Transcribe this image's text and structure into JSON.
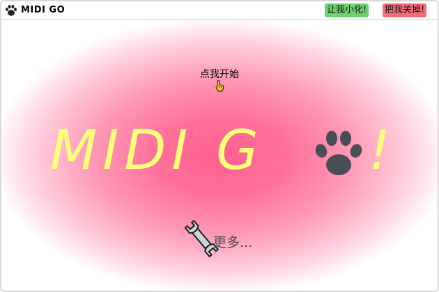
{
  "window": {
    "title": "MIDI GO",
    "icon": "paw-icon"
  },
  "titlebar": {
    "minimize_label": "让我小化!",
    "close_label": "把我关掉!",
    "minimize_color": "#6ed06e",
    "close_color": "#f26d78"
  },
  "main": {
    "start_label": "点我开始",
    "start_icon": "pointing-hand-icon",
    "logo": {
      "text": "MIDI G",
      "paw_icon": "paw-icon",
      "suffix": "!",
      "color": "#ffff7a"
    },
    "more_label": "更多...",
    "more_icon": "wrench-icon",
    "background_color": "#ff6f98"
  }
}
